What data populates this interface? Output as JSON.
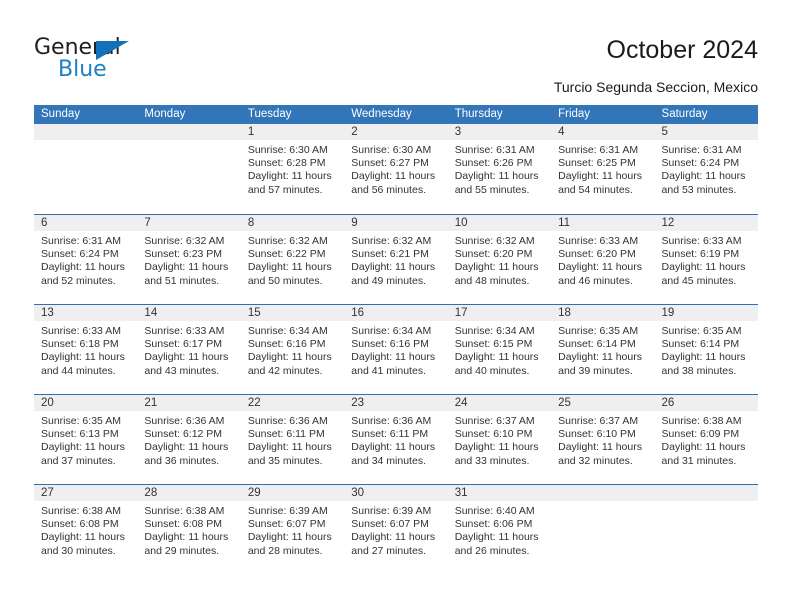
{
  "brand": {
    "name_top": "General",
    "name_bottom": "Blue",
    "accent_color": "#1f7fc4",
    "triangle_color": "#1271b8"
  },
  "header": {
    "title": "October 2024",
    "subtitle": "Turcio Segunda Seccion, Mexico"
  },
  "theme": {
    "header_blue": "#3275b8",
    "row_divider_blue": "#2f6fb0",
    "daynum_gray": "#efefef"
  },
  "weekdays": [
    "Sunday",
    "Monday",
    "Tuesday",
    "Wednesday",
    "Thursday",
    "Friday",
    "Saturday"
  ],
  "labels": {
    "sunrise": "Sunrise:",
    "sunset": "Sunset:",
    "daylight": "Daylight:"
  },
  "weeks": [
    [
      {
        "day": "",
        "sunrise": "",
        "sunset": "",
        "daylight_line1": "",
        "daylight_line2": ""
      },
      {
        "day": "",
        "sunrise": "",
        "sunset": "",
        "daylight_line1": "",
        "daylight_line2": ""
      },
      {
        "day": "1",
        "sunrise": "Sunrise: 6:30 AM",
        "sunset": "Sunset: 6:28 PM",
        "daylight_line1": "Daylight: 11 hours",
        "daylight_line2": "and 57 minutes."
      },
      {
        "day": "2",
        "sunrise": "Sunrise: 6:30 AM",
        "sunset": "Sunset: 6:27 PM",
        "daylight_line1": "Daylight: 11 hours",
        "daylight_line2": "and 56 minutes."
      },
      {
        "day": "3",
        "sunrise": "Sunrise: 6:31 AM",
        "sunset": "Sunset: 6:26 PM",
        "daylight_line1": "Daylight: 11 hours",
        "daylight_line2": "and 55 minutes."
      },
      {
        "day": "4",
        "sunrise": "Sunrise: 6:31 AM",
        "sunset": "Sunset: 6:25 PM",
        "daylight_line1": "Daylight: 11 hours",
        "daylight_line2": "and 54 minutes."
      },
      {
        "day": "5",
        "sunrise": "Sunrise: 6:31 AM",
        "sunset": "Sunset: 6:24 PM",
        "daylight_line1": "Daylight: 11 hours",
        "daylight_line2": "and 53 minutes."
      }
    ],
    [
      {
        "day": "6",
        "sunrise": "Sunrise: 6:31 AM",
        "sunset": "Sunset: 6:24 PM",
        "daylight_line1": "Daylight: 11 hours",
        "daylight_line2": "and 52 minutes."
      },
      {
        "day": "7",
        "sunrise": "Sunrise: 6:32 AM",
        "sunset": "Sunset: 6:23 PM",
        "daylight_line1": "Daylight: 11 hours",
        "daylight_line2": "and 51 minutes."
      },
      {
        "day": "8",
        "sunrise": "Sunrise: 6:32 AM",
        "sunset": "Sunset: 6:22 PM",
        "daylight_line1": "Daylight: 11 hours",
        "daylight_line2": "and 50 minutes."
      },
      {
        "day": "9",
        "sunrise": "Sunrise: 6:32 AM",
        "sunset": "Sunset: 6:21 PM",
        "daylight_line1": "Daylight: 11 hours",
        "daylight_line2": "and 49 minutes."
      },
      {
        "day": "10",
        "sunrise": "Sunrise: 6:32 AM",
        "sunset": "Sunset: 6:20 PM",
        "daylight_line1": "Daylight: 11 hours",
        "daylight_line2": "and 48 minutes."
      },
      {
        "day": "11",
        "sunrise": "Sunrise: 6:33 AM",
        "sunset": "Sunset: 6:20 PM",
        "daylight_line1": "Daylight: 11 hours",
        "daylight_line2": "and 46 minutes."
      },
      {
        "day": "12",
        "sunrise": "Sunrise: 6:33 AM",
        "sunset": "Sunset: 6:19 PM",
        "daylight_line1": "Daylight: 11 hours",
        "daylight_line2": "and 45 minutes."
      }
    ],
    [
      {
        "day": "13",
        "sunrise": "Sunrise: 6:33 AM",
        "sunset": "Sunset: 6:18 PM",
        "daylight_line1": "Daylight: 11 hours",
        "daylight_line2": "and 44 minutes."
      },
      {
        "day": "14",
        "sunrise": "Sunrise: 6:33 AM",
        "sunset": "Sunset: 6:17 PM",
        "daylight_line1": "Daylight: 11 hours",
        "daylight_line2": "and 43 minutes."
      },
      {
        "day": "15",
        "sunrise": "Sunrise: 6:34 AM",
        "sunset": "Sunset: 6:16 PM",
        "daylight_line1": "Daylight: 11 hours",
        "daylight_line2": "and 42 minutes."
      },
      {
        "day": "16",
        "sunrise": "Sunrise: 6:34 AM",
        "sunset": "Sunset: 6:16 PM",
        "daylight_line1": "Daylight: 11 hours",
        "daylight_line2": "and 41 minutes."
      },
      {
        "day": "17",
        "sunrise": "Sunrise: 6:34 AM",
        "sunset": "Sunset: 6:15 PM",
        "daylight_line1": "Daylight: 11 hours",
        "daylight_line2": "and 40 minutes."
      },
      {
        "day": "18",
        "sunrise": "Sunrise: 6:35 AM",
        "sunset": "Sunset: 6:14 PM",
        "daylight_line1": "Daylight: 11 hours",
        "daylight_line2": "and 39 minutes."
      },
      {
        "day": "19",
        "sunrise": "Sunrise: 6:35 AM",
        "sunset": "Sunset: 6:14 PM",
        "daylight_line1": "Daylight: 11 hours",
        "daylight_line2": "and 38 minutes."
      }
    ],
    [
      {
        "day": "20",
        "sunrise": "Sunrise: 6:35 AM",
        "sunset": "Sunset: 6:13 PM",
        "daylight_line1": "Daylight: 11 hours",
        "daylight_line2": "and 37 minutes."
      },
      {
        "day": "21",
        "sunrise": "Sunrise: 6:36 AM",
        "sunset": "Sunset: 6:12 PM",
        "daylight_line1": "Daylight: 11 hours",
        "daylight_line2": "and 36 minutes."
      },
      {
        "day": "22",
        "sunrise": "Sunrise: 6:36 AM",
        "sunset": "Sunset: 6:11 PM",
        "daylight_line1": "Daylight: 11 hours",
        "daylight_line2": "and 35 minutes."
      },
      {
        "day": "23",
        "sunrise": "Sunrise: 6:36 AM",
        "sunset": "Sunset: 6:11 PM",
        "daylight_line1": "Daylight: 11 hours",
        "daylight_line2": "and 34 minutes."
      },
      {
        "day": "24",
        "sunrise": "Sunrise: 6:37 AM",
        "sunset": "Sunset: 6:10 PM",
        "daylight_line1": "Daylight: 11 hours",
        "daylight_line2": "and 33 minutes."
      },
      {
        "day": "25",
        "sunrise": "Sunrise: 6:37 AM",
        "sunset": "Sunset: 6:10 PM",
        "daylight_line1": "Daylight: 11 hours",
        "daylight_line2": "and 32 minutes."
      },
      {
        "day": "26",
        "sunrise": "Sunrise: 6:38 AM",
        "sunset": "Sunset: 6:09 PM",
        "daylight_line1": "Daylight: 11 hours",
        "daylight_line2": "and 31 minutes."
      }
    ],
    [
      {
        "day": "27",
        "sunrise": "Sunrise: 6:38 AM",
        "sunset": "Sunset: 6:08 PM",
        "daylight_line1": "Daylight: 11 hours",
        "daylight_line2": "and 30 minutes."
      },
      {
        "day": "28",
        "sunrise": "Sunrise: 6:38 AM",
        "sunset": "Sunset: 6:08 PM",
        "daylight_line1": "Daylight: 11 hours",
        "daylight_line2": "and 29 minutes."
      },
      {
        "day": "29",
        "sunrise": "Sunrise: 6:39 AM",
        "sunset": "Sunset: 6:07 PM",
        "daylight_line1": "Daylight: 11 hours",
        "daylight_line2": "and 28 minutes."
      },
      {
        "day": "30",
        "sunrise": "Sunrise: 6:39 AM",
        "sunset": "Sunset: 6:07 PM",
        "daylight_line1": "Daylight: 11 hours",
        "daylight_line2": "and 27 minutes."
      },
      {
        "day": "31",
        "sunrise": "Sunrise: 6:40 AM",
        "sunset": "Sunset: 6:06 PM",
        "daylight_line1": "Daylight: 11 hours",
        "daylight_line2": "and 26 minutes."
      },
      {
        "day": "",
        "sunrise": "",
        "sunset": "",
        "daylight_line1": "",
        "daylight_line2": ""
      },
      {
        "day": "",
        "sunrise": "",
        "sunset": "",
        "daylight_line1": "",
        "daylight_line2": ""
      }
    ]
  ]
}
